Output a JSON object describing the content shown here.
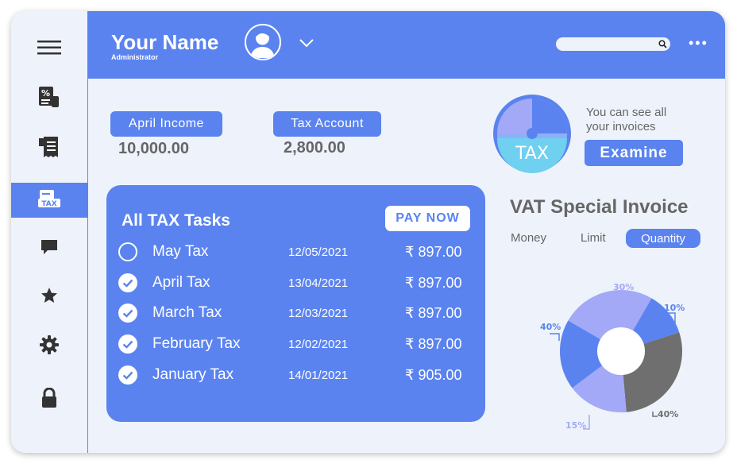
{
  "header": {
    "name": "Your Name",
    "role": "Administrator"
  },
  "sidebar": {
    "items": [
      {
        "icon": "menu-icon"
      },
      {
        "icon": "percent-receipt-icon"
      },
      {
        "icon": "receipt-icon"
      },
      {
        "icon": "tax-document-icon",
        "active": true,
        "label": "TAX"
      },
      {
        "icon": "chat-icon"
      },
      {
        "icon": "star-icon"
      },
      {
        "icon": "gear-icon"
      },
      {
        "icon": "lock-icon"
      }
    ]
  },
  "summary": {
    "income_label": "April Income",
    "income_value": "10,000.00",
    "tax_label": "Tax Account",
    "tax_value": "2,800.00"
  },
  "invoice_promo": {
    "badge": "TAX",
    "text_line1": "You can see all",
    "text_line2": "your invoices",
    "button": "Examine"
  },
  "tasks": {
    "title": "All TAX Tasks",
    "pay_button": "PAY NOW",
    "rows": [
      {
        "name": "May Tax",
        "date": "12/05/2021",
        "amount": "₹ 897.00",
        "done": false
      },
      {
        "name": "April Tax",
        "date": "13/04/2021",
        "amount": "₹ 897.00",
        "done": true
      },
      {
        "name": "March Tax",
        "date": "12/03/2021",
        "amount": "₹ 897.00",
        "done": true
      },
      {
        "name": "February Tax",
        "date": "12/02/2021",
        "amount": "₹ 897.00",
        "done": true
      },
      {
        "name": "January Tax",
        "date": "14/01/2021",
        "amount": "₹ 905.00",
        "done": true
      }
    ]
  },
  "vat": {
    "title": "VAT Special Invoice",
    "tabs": [
      "Money",
      "Limit",
      "Quantity"
    ],
    "active_tab": "Quantity"
  },
  "chart_data": {
    "type": "pie",
    "labels": [
      "30%",
      "10%",
      "40%",
      "15%",
      "40%"
    ],
    "values": [
      30,
      10,
      40,
      15,
      40
    ],
    "colors": [
      "#a3a9f7",
      "#5a83f0",
      "#6f6f6f",
      "#a3a9f7",
      "#5a83f0"
    ],
    "donut": true
  },
  "colors": {
    "accent": "#5a83f0",
    "background": "#eef3fb",
    "muted": "#6f6f6f",
    "lavender": "#a3a9f7"
  }
}
